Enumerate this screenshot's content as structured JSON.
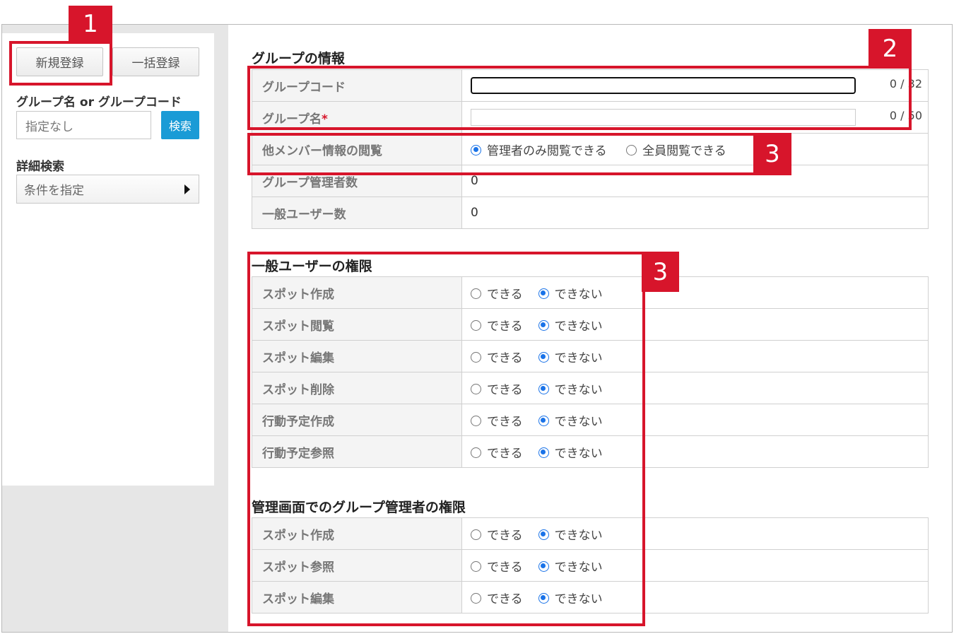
{
  "sidebar": {
    "new_button": "新規登録",
    "bulk_button": "一括登録",
    "filter_label": "グループ名 or グループコード",
    "filter_placeholder": "指定なし",
    "search_button": "検索",
    "advanced_label": "詳細検索",
    "condition_button": "条件を指定"
  },
  "group_info": {
    "title": "グループの情報",
    "rows": [
      {
        "label": "グループコード",
        "counter": "0 / 32"
      },
      {
        "label": "グループ名",
        "required_mark": "*",
        "counter": "0 / 50"
      },
      {
        "label": "他メンバー情報の閲覧",
        "options": [
          "管理者のみ閲覧できる",
          "全員閲覧できる"
        ],
        "selected": 0
      },
      {
        "label": "グループ管理者数",
        "value": "0"
      },
      {
        "label": "一般ユーザー数",
        "value": "0"
      }
    ]
  },
  "general_perms": {
    "title": "一般ユーザーの権限",
    "options": [
      "できる",
      "できない"
    ],
    "rows": [
      "スポット作成",
      "スポット閲覧",
      "スポット編集",
      "スポット削除",
      "行動予定作成",
      "行動予定参照"
    ],
    "selected": 1
  },
  "admin_perms": {
    "title": "管理画面でのグループ管理者の権限",
    "options": [
      "できる",
      "できない"
    ],
    "rows": [
      "スポット作成",
      "スポット参照",
      "スポット編集"
    ],
    "selected": 1
  },
  "annotations": [
    "1",
    "2",
    "3",
    "3"
  ],
  "colors": {
    "highlight": "#d7152b",
    "accent": "#1a9bd6",
    "radio": "#1a73e8"
  }
}
